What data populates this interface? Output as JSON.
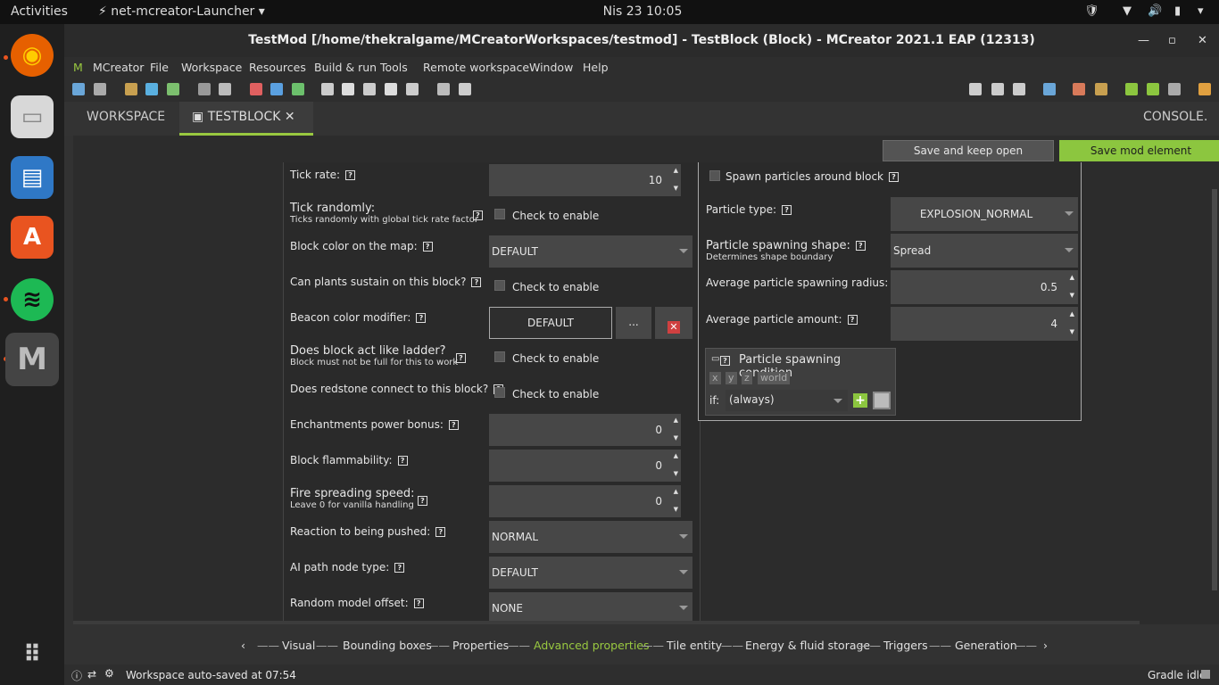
{
  "topbar": {
    "activities": "Activities",
    "app": "net-mcreator-Launcher",
    "clock": "Nis 23  10:05"
  },
  "window": {
    "title": "TestMod [/home/thekralgame/MCreatorWorkspaces/testmod] - TestBlock (Block) - MCreator 2021.1 EAP (12313)"
  },
  "menu": [
    "MCreator",
    "File",
    "Workspace",
    "Resources",
    "Build & run",
    "Tools",
    "Remote workspace",
    "Window",
    "Help"
  ],
  "tabs": {
    "workspace": "WORKSPACE",
    "testblock": "TESTBLOCK",
    "console": "CONSOLE."
  },
  "buttons": {
    "save_keep_open": "Save and keep open",
    "save_element": "Save mod element"
  },
  "left": {
    "tick_rate": {
      "label": "Tick rate:",
      "value": "10"
    },
    "tick_randomly": {
      "label": "Tick randomly:",
      "sub": "Ticks randomly with global tick rate factor",
      "check": "Check to enable"
    },
    "block_color": {
      "label": "Block color on the map:",
      "value": "DEFAULT"
    },
    "plants": {
      "label": "Can plants sustain on this block?",
      "check": "Check to enable"
    },
    "beacon": {
      "label": "Beacon color modifier:",
      "value": "DEFAULT",
      "dots": "..."
    },
    "ladder": {
      "label": "Does block act like ladder?",
      "sub": "Block must not be full for this to work",
      "check": "Check to enable"
    },
    "redstone": {
      "label": "Does redstone connect to this block?",
      "check": "Check to enable"
    },
    "enchant": {
      "label": "Enchantments power bonus:",
      "value": "0"
    },
    "flammability": {
      "label": "Block flammability:",
      "value": "0"
    },
    "fire": {
      "label": "Fire spreading speed:",
      "sub": "Leave 0 for vanilla handling",
      "value": "0"
    },
    "pushed": {
      "label": "Reaction to being pushed:",
      "value": "NORMAL"
    },
    "ai_path": {
      "label": "AI path node type:",
      "value": "DEFAULT"
    },
    "offset": {
      "label": "Random model offset:",
      "value": "NONE"
    }
  },
  "right": {
    "spawn": "Spawn particles around block",
    "ptype": {
      "label": "Particle type:",
      "value": "EXPLOSION_NORMAL"
    },
    "pshape": {
      "label": "Particle spawning shape:",
      "sub": "Determines shape boundary",
      "value": "Spread"
    },
    "pradius": {
      "label": "Average particle spawning radius:",
      "value": "0.5"
    },
    "pamount": {
      "label": "Average particle amount:",
      "value": "4"
    },
    "pcond": {
      "title": "Particle spawning condition",
      "tags": [
        "x",
        "y",
        "z",
        "world"
      ],
      "if": "if:",
      "value": "(always)"
    }
  },
  "nav": [
    "Visual",
    "Bounding boxes",
    "Properties",
    "Advanced properties",
    "Tile entity",
    "Energy & fluid storage",
    "Triggers",
    "Generation"
  ],
  "status": {
    "text": "Workspace auto-saved at 07:54",
    "gradle": "Gradle idle"
  },
  "colors": {
    "accent": "#99c940",
    "save": "#8cc63f"
  }
}
